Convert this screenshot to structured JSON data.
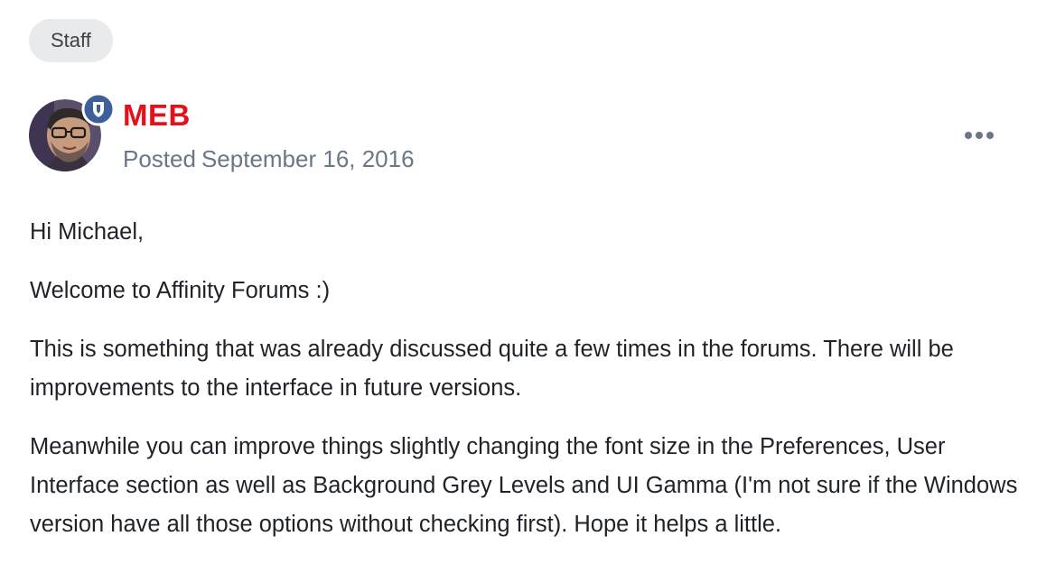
{
  "badge": {
    "label": "Staff"
  },
  "author": {
    "name": "MEB",
    "name_color": "#e5101a",
    "avatar_icon": "user-avatar",
    "role_icon": "shield-badge-icon"
  },
  "meta": {
    "posted_label": "Posted",
    "date": "September 16, 2016"
  },
  "menu": {
    "icon": "ellipsis-icon"
  },
  "post": {
    "paragraphs": [
      "Hi Michael,",
      "Welcome to Affinity Forums :)",
      "This is something that was already discussed quite a few times in the forums. There will be improvements to the interface in future versions.",
      "Meanwhile you can improve things slightly changing the font size in the Preferences, User Interface section as well as Background Grey Levels and UI Gamma (I'm not sure if the Windows version have all those options without checking first). Hope it helps a little."
    ]
  }
}
